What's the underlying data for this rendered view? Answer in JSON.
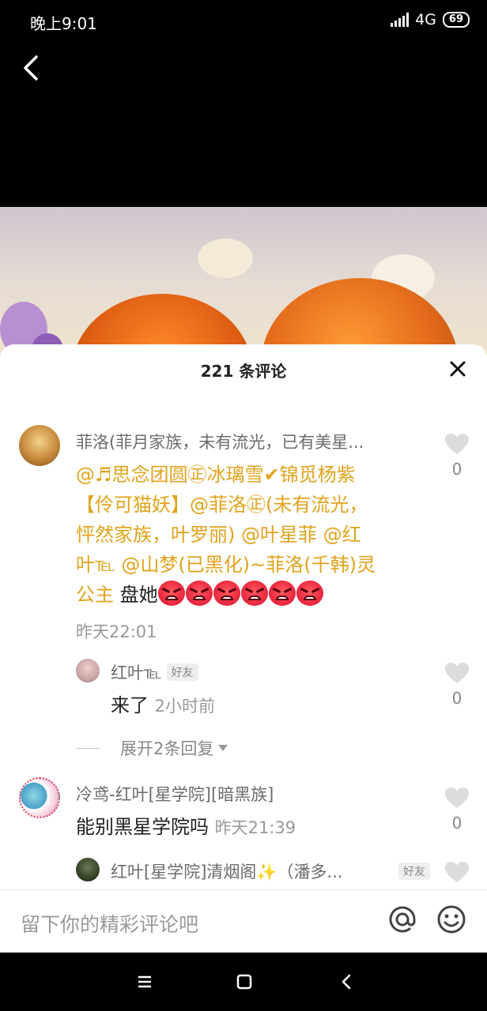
{
  "status_bar": {
    "time": "晚上9:01",
    "network": "4G",
    "battery": "69"
  },
  "comments_header": {
    "title": "221 条评论"
  },
  "comments": [
    {
      "name": "菲洛(菲月家族，未有流光，已有美星...",
      "mentions_line1": "@♬思念团圆㊣冰璃雪✔锦觅杨紫",
      "mentions_line2": "【伶可猫妖】@菲洛㊣(未有流光，",
      "mentions_line3": "怦然家族，叶罗丽) @叶星菲 @红",
      "mentions_line4": "叶℡ @山梦(已黑化)~菲洛(千韩)灵",
      "mentions_line5a": "公主",
      "text_tail": " 盘她",
      "time": "昨天22:01",
      "likes": "0"
    },
    {
      "name": "红叶℡",
      "badge": "好友",
      "text": "来了",
      "time": "2小时前",
      "likes": "0"
    },
    {
      "expand_label": "展开2条回复"
    },
    {
      "name": "冷鸢-红叶[星学院][暗黑族]",
      "text": "能别黑星学院吗",
      "time": "昨天21:39",
      "likes": "0"
    },
    {
      "name": "红叶[星学院]清烟阁✨（潘多...",
      "badge": "好友"
    }
  ],
  "input_bar": {
    "placeholder": "留下你的精彩评论吧"
  },
  "icons": {
    "back": "chevron-left-icon",
    "close": "close-icon",
    "like": "heart-icon",
    "at": "at-icon",
    "emoji": "smiley-icon",
    "menu": "menu-icon",
    "home": "home-icon",
    "back_nav": "back-icon"
  },
  "colors": {
    "mention": "#e1a31c",
    "meta": "#999999",
    "background": "#000000"
  }
}
